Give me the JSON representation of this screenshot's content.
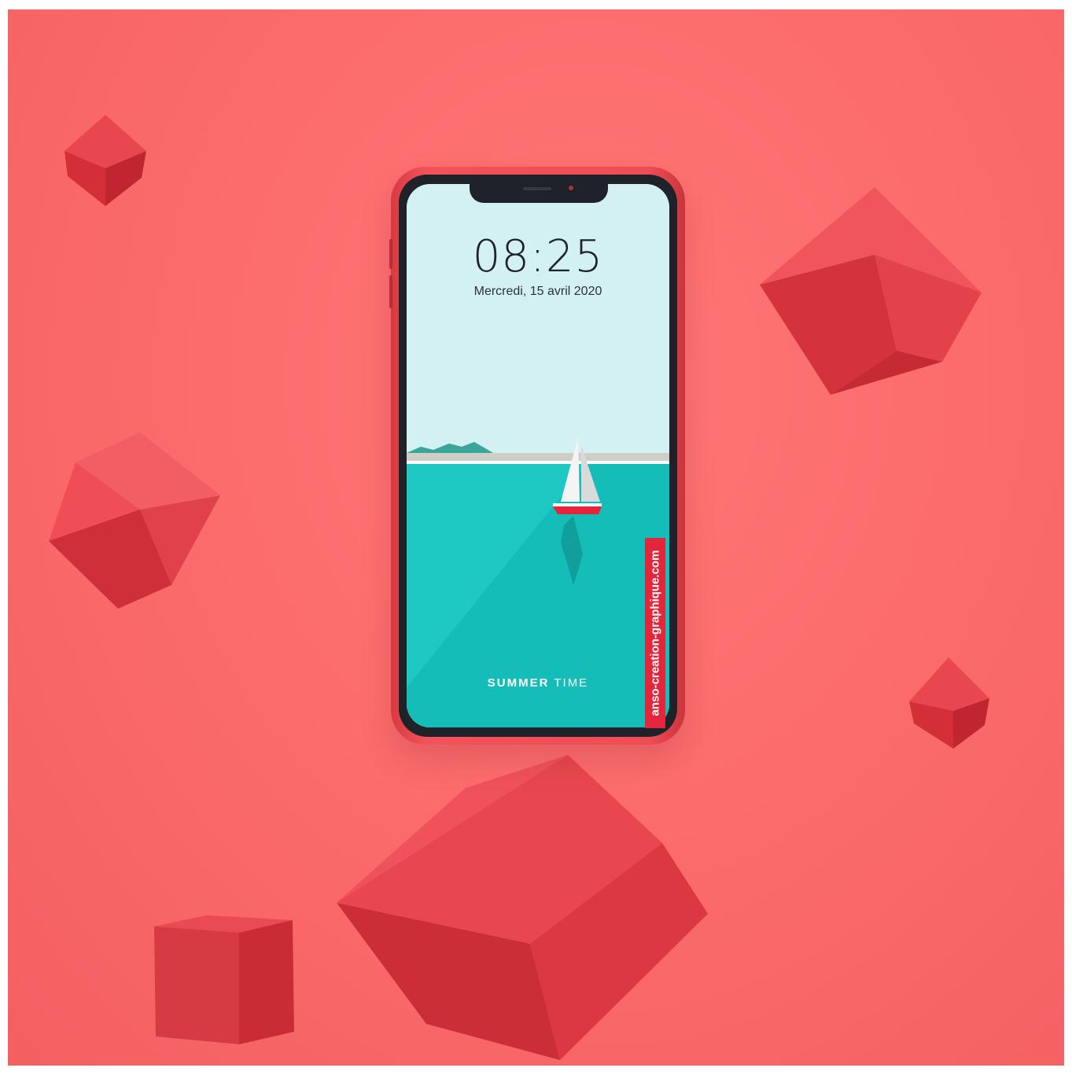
{
  "scene": {
    "background_color": "#fb6a6b",
    "cube_color": "#e03a44"
  },
  "phone": {
    "frame_color": "#ef4c54",
    "lock_screen": {
      "time": "08:25",
      "date": "Mercredi, 15 avril 2020",
      "caption_bold": "SUMMER",
      "caption_light": "TIME",
      "sky_color": "#d3f0f3",
      "sea_color": "#1ec9c4"
    }
  },
  "watermark": {
    "text": "anso-creation-graphique.com",
    "color": "#e3263b"
  }
}
